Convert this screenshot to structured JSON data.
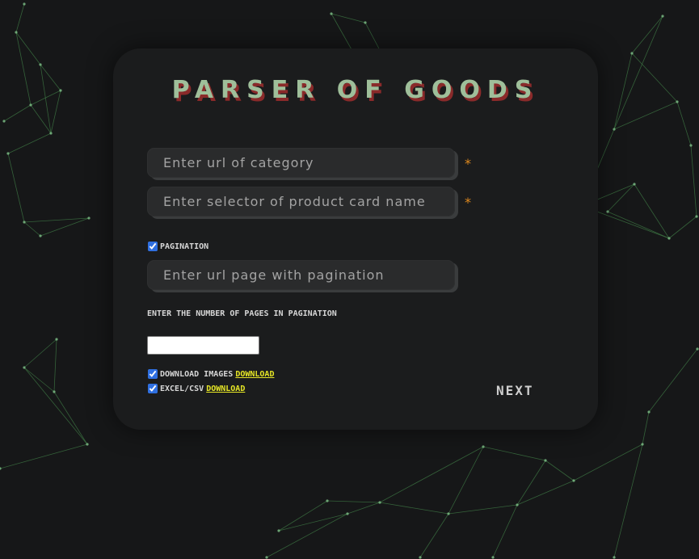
{
  "title": "PARSER OF GOODS",
  "fields": {
    "category_url_placeholder": "Enter url of category",
    "selector_placeholder": "Enter selector of product card name",
    "pagination_url_placeholder": "Enter url page with pagination",
    "required_mark": "*"
  },
  "pagination": {
    "label": "PAGINATION",
    "checked": true
  },
  "pages_count_label": "ENTER THE NUMBER OF PAGES IN PAGINATION",
  "downloads": {
    "images_label": "DOWNLOAD IMAGES",
    "images_link": "DOWNLOAD",
    "images_checked": true,
    "csv_label": "EXCEL/CSV",
    "csv_link": "DOWNLOAD",
    "csv_checked": true
  },
  "next_label": "NEXT",
  "colors": {
    "background": "#161718",
    "card": "#1b1c1d",
    "title": "#9fbf9a",
    "title_shadow": "#8a2a2a",
    "required": "#e08a1e",
    "link": "#e6e626",
    "network_lines": "#3f7a45"
  }
}
